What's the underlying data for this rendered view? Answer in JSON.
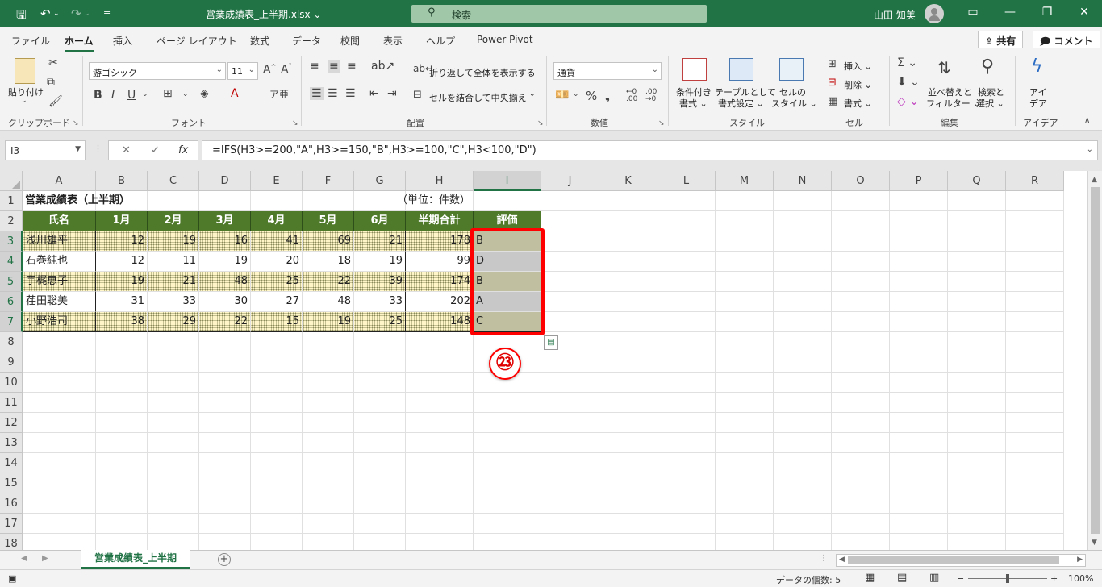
{
  "titlebar": {
    "document_title": "営業成績表_上半期.xlsx",
    "search_label": "検索",
    "user_name": "山田 知美"
  },
  "tabs": [
    "ファイル",
    "ホーム",
    "挿入",
    "ページ レイアウト",
    "数式",
    "データ",
    "校閲",
    "表示",
    "ヘルプ",
    "Power Pivot"
  ],
  "active_tab": "ホーム",
  "share_button": "共有",
  "comment_button": "コメント",
  "ribbon": {
    "clipboard": {
      "label": "クリップボード",
      "paste": "貼り付け"
    },
    "font": {
      "label": "フォント",
      "font_name": "游ゴシック",
      "font_size": "11"
    },
    "alignment": {
      "label": "配置",
      "wrap_text": "折り返して全体を表示する",
      "merge_center": "セルを結合して中央揃え"
    },
    "number": {
      "label": "数値",
      "format": "通貨"
    },
    "styles": {
      "label": "スタイル",
      "conditional": [
        "条件付き",
        "書式"
      ],
      "as_table": [
        "テーブルとして",
        "書式設定"
      ],
      "cell_styles": [
        "セルの",
        "スタイル"
      ]
    },
    "cells": {
      "label": "セル",
      "insert": "挿入",
      "delete": "削除",
      "format": "書式"
    },
    "editing": {
      "label": "編集",
      "sort": [
        "並べ替えと",
        "フィルター"
      ],
      "find": [
        "検索と",
        "選択"
      ]
    },
    "ideas": {
      "label": "アイデア",
      "button": [
        "アイ",
        "デア"
      ]
    }
  },
  "formula_bar": {
    "name_box": "I3",
    "formula": "=IFS(H3>=200,\"A\",H3>=150,\"B\",H3>=100,\"C\",H3<100,\"D\")"
  },
  "sheet": {
    "columns": [
      "A",
      "B",
      "C",
      "D",
      "E",
      "F",
      "G",
      "H",
      "I",
      "J",
      "K",
      "L",
      "M",
      "N",
      "O",
      "P",
      "Q",
      "R"
    ],
    "rows": [
      "1",
      "2",
      "3",
      "4",
      "5",
      "6",
      "7",
      "8",
      "9",
      "10",
      "11",
      "12",
      "13",
      "14",
      "15",
      "16",
      "17",
      "18"
    ],
    "title": "営業成績表（上半期）",
    "unit": "（単位：件数）",
    "headers": [
      "氏名",
      "1月",
      "2月",
      "3月",
      "4月",
      "5月",
      "6月",
      "半期合計",
      "評価"
    ],
    "data": [
      [
        "浅川雄平",
        "12",
        "19",
        "16",
        "41",
        "69",
        "21",
        "178",
        "B"
      ],
      [
        "石巻純也",
        "12",
        "11",
        "19",
        "20",
        "18",
        "19",
        "99",
        "D"
      ],
      [
        "宇梶恵子",
        "19",
        "21",
        "48",
        "25",
        "22",
        "39",
        "174",
        "B"
      ],
      [
        "荏田聡美",
        "31",
        "33",
        "30",
        "27",
        "48",
        "33",
        "202",
        "A"
      ],
      [
        "小野浩司",
        "38",
        "29",
        "22",
        "15",
        "19",
        "25",
        "148",
        "C"
      ]
    ]
  },
  "annotation_badge": "㉓",
  "sheet_tab": "営業成績表_上半期",
  "status": {
    "count": "データの個数: 5",
    "zoom": "100%"
  }
}
